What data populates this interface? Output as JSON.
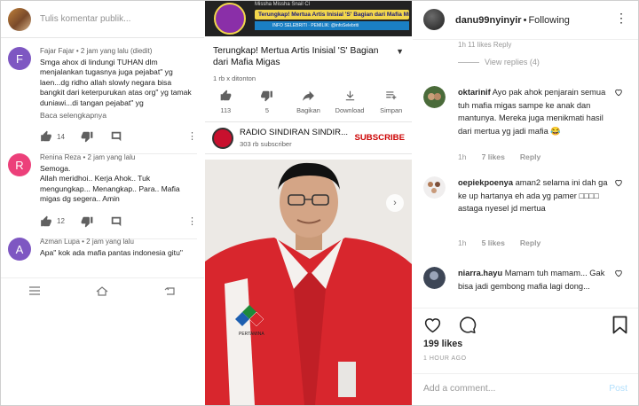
{
  "yt_comments": {
    "placeholder": "Tulis komentar publik...",
    "comments": [
      {
        "avatar_letter": "F",
        "avatar_color": "#7e57c2",
        "header": "Fajar Fajar • 2 jam yang lalu (diedit)",
        "text": "Smga ahox di lindungi TUHAN dlm menjalankan tugasnya juga pejabat\" yg laen...dg ridho allah slowly negara bisa bangkit dari keterpurukan atas org\" yg tamak duniawi...di tangan pejabat\" yg",
        "more": "Baca selengkapnya",
        "likes": "14"
      },
      {
        "avatar_letter": "R",
        "avatar_color": "#ec407a",
        "header": "Renina Reza • 2 jam yang lalu",
        "text": "Semoga.\nAllah meridhoi.. Kerja Ahok.. Tuk mengungkap... Menangkap.. Para.. Mafia migas dg segera.. Amin",
        "likes": "12"
      },
      {
        "avatar_letter": "A",
        "avatar_color": "#7e57c2",
        "header": "Azman Lupa • 2 jam yang lalu",
        "text": "Apa\" kok ada mafia pantas indonesia gitu\""
      }
    ]
  },
  "yt_video": {
    "thumb_top": "Missha Missha Snail Cl",
    "thumb_banner": "Terungkap! Mertua Artis Inisial 'S' Bagian dari Mafia Migas?",
    "thumb_strip": "INFO SELEBRITI · PEMILIK: @infoSelebriti",
    "title": "Terungkap! Mertua Artis Inisial 'S' Bagian dari Mafia Migas",
    "views": "1 rb x ditonton",
    "actions": {
      "like_count": "113",
      "dislike_count": "5",
      "share": "Bagikan",
      "download": "Download",
      "save": "Simpan"
    },
    "channel_name": "RADIO SINDIRAN SINDIR...",
    "subscribers": "303 rb subscriber",
    "subscribe": "SUBSCRIBE"
  },
  "photo": {
    "logo_text": "PERTAMINA"
  },
  "instagram": {
    "username": "danu99nyinyir",
    "separator": "•",
    "follow_status": "Following",
    "partial_meta": "1h    11 likes    Reply",
    "view_replies": "View replies (4)",
    "comments": [
      {
        "user": "oktarinif",
        "text": "Ayo pak ahok penjarain semua tuh mafia migas sampe ke anak dan mantunya. Mereka juga menikmati hasil dari mertua yg jadi mafia 😂",
        "time": "1h",
        "likes": "7 likes",
        "reply": "Reply"
      },
      {
        "user": "oepiekpoenya",
        "text": "aman2 selama ini dah ga ke up hartanya eh ada yg pamer ⁣⁣⁣⁣ astaga nyesel jd mertua",
        "text_display": "aman2 selama ini dah ga ke up hartanya eh ada yg pamer □□□□ astaga nyesel jd mertua",
        "time": "1h",
        "likes": "5 likes",
        "reply": "Reply"
      },
      {
        "user": "niarra.hayu",
        "text": "Mamam tuh mamam... Gak bisa jadi gembong mafia lagi dong..."
      }
    ],
    "likes_count": "199 likes",
    "timestamp": "1 HOUR AGO",
    "add_comment_placeholder": "Add a comment...",
    "post_label": "Post"
  }
}
